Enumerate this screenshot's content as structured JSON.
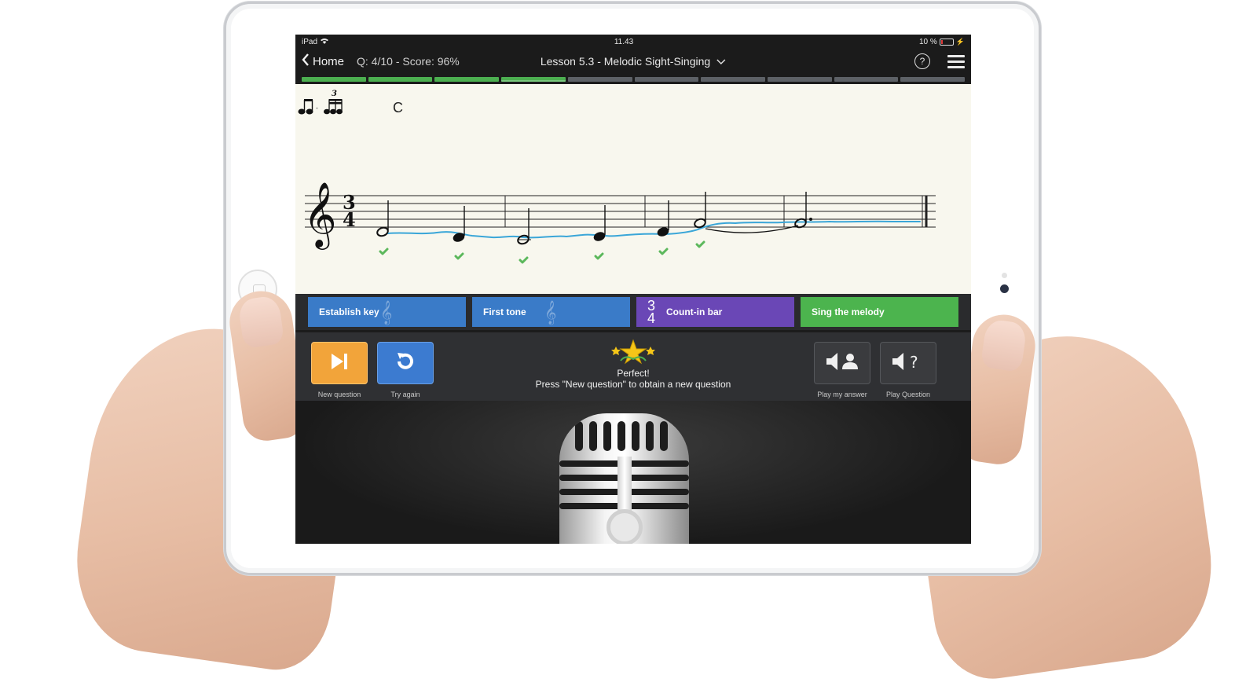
{
  "statusbar": {
    "device": "iPad",
    "time": "11.43",
    "battery": "10 %",
    "battery_level": 0.1
  },
  "navbar": {
    "back_label": "Home",
    "score": "Q: 4/10 - Score: 96%",
    "lesson_title": "Lesson 5.3 - Melodic Sight-Singing"
  },
  "progress": {
    "total": 10,
    "completed": 3,
    "current": 4
  },
  "sheet": {
    "chord": "C",
    "time_signature": {
      "top": "3",
      "bottom": "4"
    },
    "tuplet_mark": "3"
  },
  "controls": {
    "establish_key": "Establish key",
    "first_tone": "First tone",
    "count_in": "Count-in bar",
    "count_in_top": "3",
    "count_in_bottom": "4",
    "sing": "Sing the melody"
  },
  "feedback": {
    "result": "Perfect!",
    "message": "Press \"New question\" to obtain a new question",
    "new_question": "New question",
    "try_again": "Try again",
    "play_my_answer": "Play my answer",
    "play_question": "Play Question"
  },
  "colors": {
    "progress_done": "#4caf50",
    "progress_pending": "#5d6166",
    "establish_key": "#3a7bc8",
    "count_in": "#6a47b6",
    "sing": "#4cb44e",
    "new_question": "#f2a43a",
    "try_again": "#3c7bd0",
    "pitch_trace": "#3aa6d8",
    "check": "#5cb85c"
  }
}
